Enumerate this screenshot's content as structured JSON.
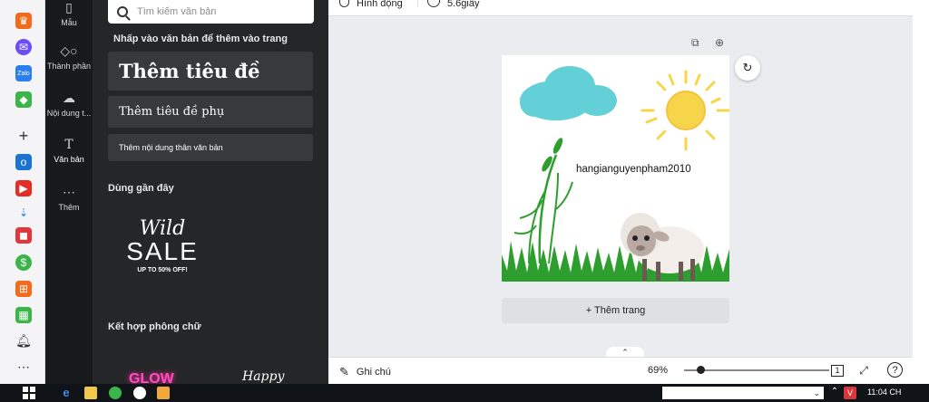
{
  "rail": {
    "items": [
      {
        "label": "Mẫu",
        "icon": "template-icon"
      },
      {
        "label": "Thành phần",
        "icon": "elements-icon"
      },
      {
        "label": "Nội dung t...",
        "icon": "upload-icon"
      },
      {
        "label": "Văn bản",
        "icon": "text-icon"
      },
      {
        "label": "Thêm",
        "icon": "more-icon"
      }
    ]
  },
  "panel": {
    "search_placeholder": "Tìm kiếm văn bản",
    "hint": "Nhấp vào văn bản để thêm vào trang",
    "heading_label": "Thêm tiêu đề",
    "subheading_label": "Thêm tiêu đề phụ",
    "body_label": "Thêm nội dung thân văn bản",
    "recent_title": "Dùng gần đây",
    "recent_sample": {
      "line1": "Wild",
      "line2": "SALE",
      "line3": "UP TO 50% OFF!"
    },
    "combo_title": "Kết hợp phông chữ",
    "combo_sample_1": "GLOW",
    "combo_sample_2": "Happy"
  },
  "topbar": {
    "animation_label": "Hình động",
    "duration_label": "5.6giây"
  },
  "canvas": {
    "text": "hangianguyenpham2010",
    "add_page": "+ Thêm trang"
  },
  "bottombar": {
    "notes_label": "Ghi chú",
    "zoom": "69%",
    "zoom_fraction": 0.11,
    "page_count": "1"
  },
  "taskbar": {
    "time": "11:04 CH"
  },
  "colors": {
    "rail_bg": "#18191b",
    "panel_bg": "#252627",
    "editor_bg": "#ebecf0",
    "cloud": "#63cfd6",
    "sun": "#f7d54a",
    "grass": "#2e9e2e"
  }
}
